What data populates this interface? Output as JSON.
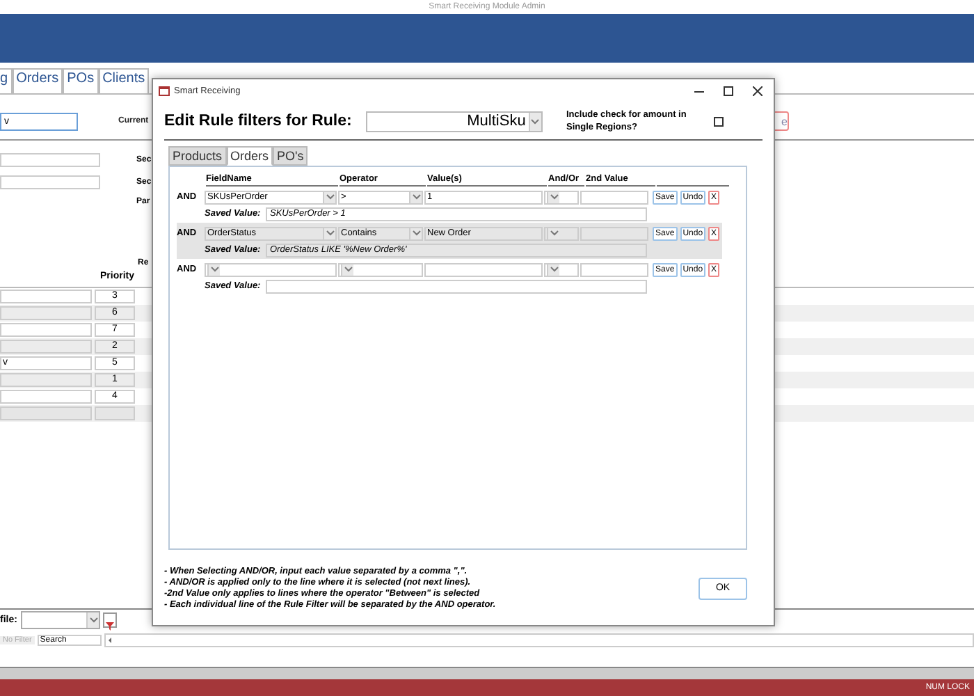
{
  "app": {
    "title": "Smart Receiving Module Admin",
    "tabs": [
      {
        "label": "g",
        "selected": false
      },
      {
        "label": "Orders",
        "selected": false
      },
      {
        "label": "POs",
        "selected": false
      },
      {
        "label": "Clients",
        "selected": false
      }
    ]
  },
  "form": {
    "search_value": "v",
    "current_label": "Current",
    "side_labels": [
      "Sec",
      "Sec",
      "Par",
      "Re"
    ],
    "side_button": "e",
    "priority_table": {
      "column": "Priority",
      "rows": [
        {
          "priority": "3"
        },
        {
          "priority": "6"
        },
        {
          "priority": "7"
        },
        {
          "priority": "2"
        },
        {
          "column_1": "v",
          "priority": "5"
        },
        {
          "priority": "1"
        },
        {
          "priority": "4"
        },
        {}
      ]
    }
  },
  "bottom": {
    "filter_label": "file:",
    "nav_filter": {
      "label": "No Filter",
      "disabled": true
    },
    "nav_search": "Search",
    "status": "NUM LOCK"
  },
  "dialog": {
    "title": "Smart Receiving",
    "heading": "Edit Rule filters for Rule:",
    "rule": "MultiSku",
    "include_check": {
      "label": "Include check for amount in Single Regions?",
      "checked": false
    },
    "tabs": [
      {
        "label": "Products",
        "selected": false
      },
      {
        "label": "Orders",
        "selected": true
      },
      {
        "label": "PO's",
        "selected": false
      }
    ],
    "columns": [
      "FieldName",
      "Operator",
      "Value(s)",
      "And/Or",
      "2nd Value"
    ],
    "rows": [
      {
        "connector": "AND",
        "field": "SKUsPerOrder",
        "operator": ">",
        "value": "1",
        "saved_label": "Saved Value:",
        "saved_value": "SKUsPerOrder > 1",
        "selected": false,
        "actions": [
          "Save",
          "Undo",
          "X"
        ]
      },
      {
        "connector": "AND",
        "field": "OrderStatus",
        "operator": "Contains",
        "value": "New Order",
        "saved_label": "Saved Value:",
        "saved_value": "OrderStatus LIKE '%New Order%'",
        "selected": true,
        "actions": [
          "Save",
          "Undo",
          "X"
        ]
      },
      {
        "connector": "AND",
        "saved_label": "Saved Value:",
        "selected": false,
        "actions": [
          "Save",
          "Undo",
          "X"
        ]
      }
    ],
    "notes": [
      "- When Selecting AND/OR, input each value separated by a comma \",\".",
      "- AND/OR is applied only to the line where it is selected (not next lines).",
      "-2nd Value only applies to lines where the operator \"Between\" is selected",
      "- Each individual line of the Rule Filter will be separated by the AND operator."
    ],
    "ok": "OK"
  }
}
